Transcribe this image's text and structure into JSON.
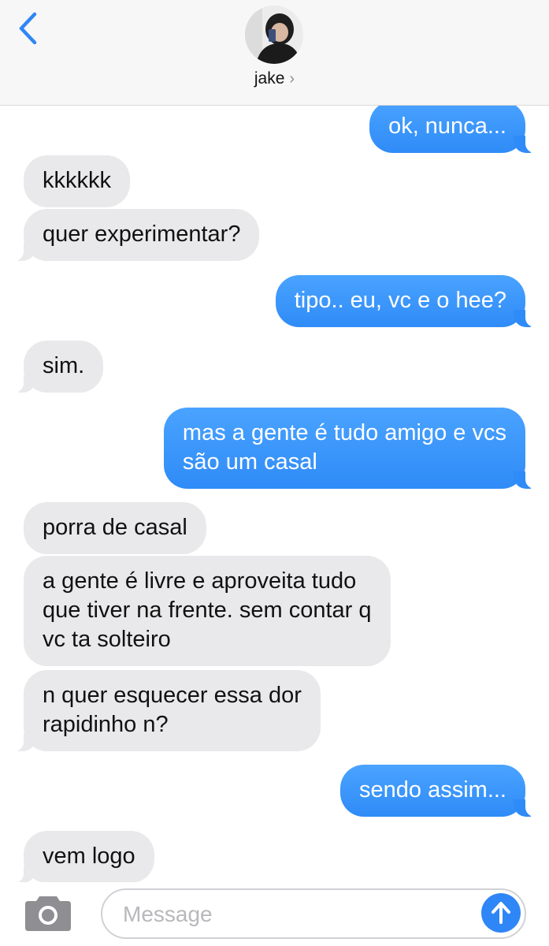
{
  "header": {
    "contact_name": "jake",
    "chevron": "›",
    "back_icon": "chevron-left-icon",
    "accent_color": "#2f86f6"
  },
  "messages": [
    {
      "sender": "me",
      "text": "ok, nunca..."
    },
    {
      "sender": "them",
      "text": "kkkkkk"
    },
    {
      "sender": "them",
      "text": "quer experimentar?"
    },
    {
      "sender": "me",
      "text": "tipo.. eu, vc e o hee?"
    },
    {
      "sender": "them",
      "text": "sim."
    },
    {
      "sender": "me",
      "lines": [
        "mas a gente é tudo amigo e vcs",
        "são um casal"
      ]
    },
    {
      "sender": "them",
      "text": "porra de casal"
    },
    {
      "sender": "them",
      "lines": [
        "a gente é livre e aproveita tudo",
        "que tiver na frente. sem contar q",
        "vc ta solteiro"
      ]
    },
    {
      "sender": "them",
      "lines": [
        "n quer esquecer essa dor",
        "rapidinho n?"
      ]
    },
    {
      "sender": "me",
      "text": "sendo assim..."
    },
    {
      "sender": "them",
      "text": "vem logo"
    }
  ],
  "composer": {
    "placeholder": "Message",
    "value": "",
    "camera_icon": "camera-icon",
    "send_icon": "arrow-up-icon"
  }
}
